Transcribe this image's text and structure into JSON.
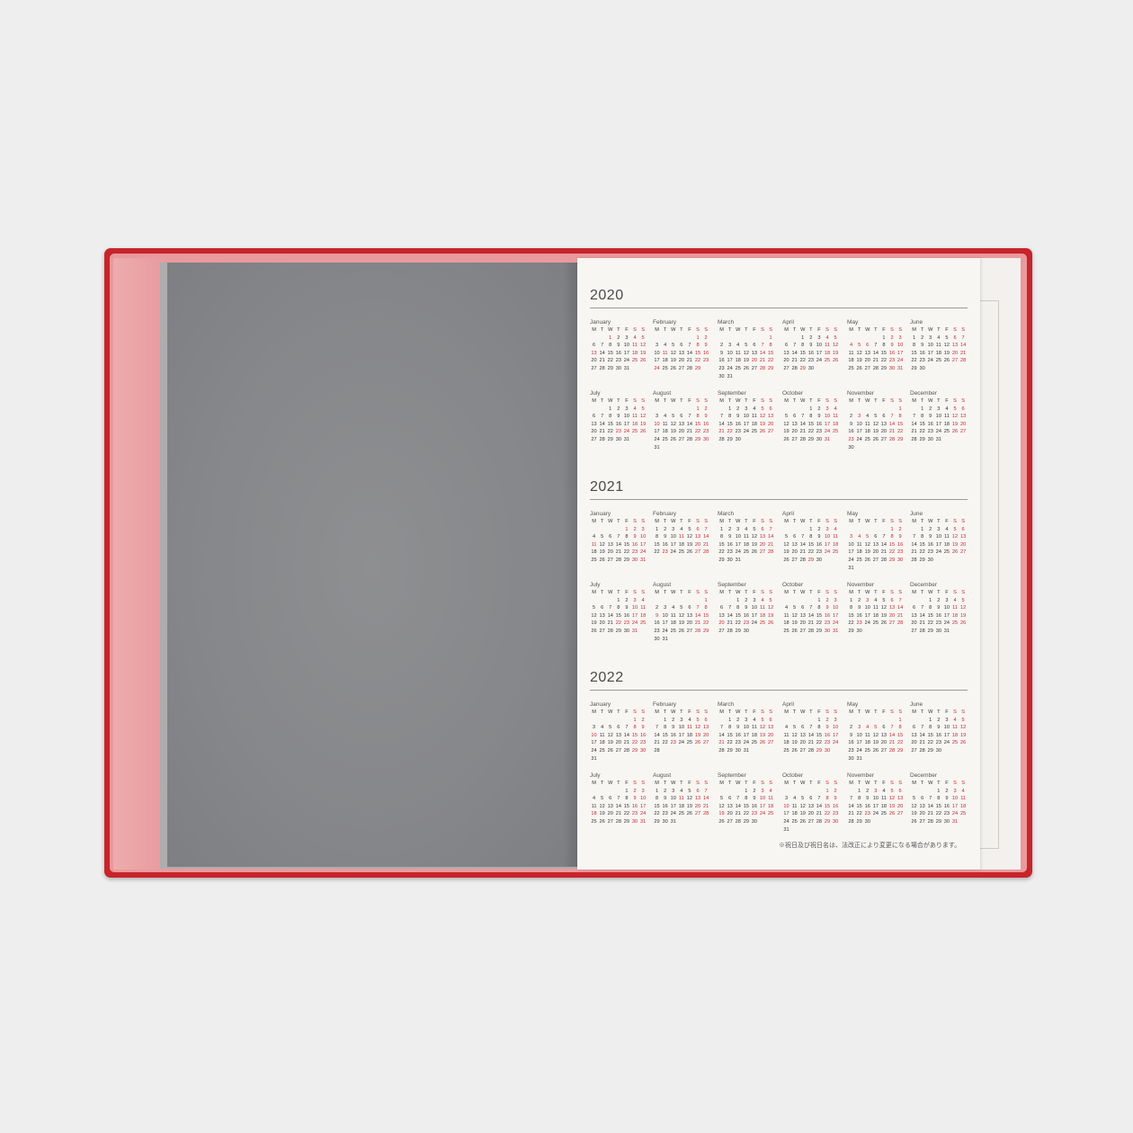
{
  "colors": {
    "cover": "#c8242b",
    "left_page": "#86878a",
    "right_page": "#f7f6f3",
    "holiday_red": "#c8242b"
  },
  "weekday_header": [
    "M",
    "T",
    "W",
    "T",
    "F",
    "S",
    "S"
  ],
  "footnote": "※祝日及び祝日名は、法改正により変更になる場合があります。",
  "years": [
    {
      "year": "2020",
      "months": [
        {
          "name": "January",
          "offset": 2,
          "days": 31,
          "holidays": [
            1,
            13
          ]
        },
        {
          "name": "February",
          "offset": 5,
          "days": 29,
          "holidays": [
            11,
            24
          ]
        },
        {
          "name": "March",
          "offset": 6,
          "days": 31,
          "holidays": [
            20
          ]
        },
        {
          "name": "April",
          "offset": 2,
          "days": 30,
          "holidays": [
            29
          ]
        },
        {
          "name": "May",
          "offset": 4,
          "days": 31,
          "holidays": [
            4,
            5,
            6
          ]
        },
        {
          "name": "June",
          "offset": 0,
          "days": 30,
          "holidays": []
        },
        {
          "name": "July",
          "offset": 2,
          "days": 31,
          "holidays": [
            23,
            24
          ]
        },
        {
          "name": "August",
          "offset": 5,
          "days": 31,
          "holidays": [
            10
          ]
        },
        {
          "name": "September",
          "offset": 1,
          "days": 30,
          "holidays": [
            21,
            22
          ]
        },
        {
          "name": "October",
          "offset": 3,
          "days": 31,
          "holidays": []
        },
        {
          "name": "November",
          "offset": 6,
          "days": 30,
          "holidays": [
            3,
            23
          ]
        },
        {
          "name": "December",
          "offset": 1,
          "days": 31,
          "holidays": []
        }
      ]
    },
    {
      "year": "2021",
      "months": [
        {
          "name": "January",
          "offset": 4,
          "days": 31,
          "holidays": [
            1,
            11
          ]
        },
        {
          "name": "February",
          "offset": 0,
          "days": 28,
          "holidays": [
            11,
            23
          ]
        },
        {
          "name": "March",
          "offset": 0,
          "days": 31,
          "holidays": [
            20
          ]
        },
        {
          "name": "April",
          "offset": 3,
          "days": 30,
          "holidays": [
            29
          ]
        },
        {
          "name": "May",
          "offset": 5,
          "days": 31,
          "holidays": [
            3,
            4,
            5
          ]
        },
        {
          "name": "June",
          "offset": 1,
          "days": 30,
          "holidays": []
        },
        {
          "name": "July",
          "offset": 3,
          "days": 31,
          "holidays": [
            22,
            23
          ]
        },
        {
          "name": "August",
          "offset": 6,
          "days": 31,
          "holidays": [
            8,
            9
          ]
        },
        {
          "name": "September",
          "offset": 2,
          "days": 30,
          "holidays": [
            20,
            23
          ]
        },
        {
          "name": "October",
          "offset": 4,
          "days": 31,
          "holidays": []
        },
        {
          "name": "November",
          "offset": 0,
          "days": 30,
          "holidays": [
            3,
            23
          ]
        },
        {
          "name": "December",
          "offset": 2,
          "days": 31,
          "holidays": []
        }
      ]
    },
    {
      "year": "2022",
      "months": [
        {
          "name": "January",
          "offset": 5,
          "days": 31,
          "holidays": [
            1,
            10
          ]
        },
        {
          "name": "February",
          "offset": 1,
          "days": 28,
          "holidays": [
            11,
            23
          ]
        },
        {
          "name": "March",
          "offset": 1,
          "days": 31,
          "holidays": [
            21
          ]
        },
        {
          "name": "April",
          "offset": 4,
          "days": 30,
          "holidays": [
            29
          ]
        },
        {
          "name": "May",
          "offset": 6,
          "days": 31,
          "holidays": [
            3,
            4,
            5
          ]
        },
        {
          "name": "June",
          "offset": 2,
          "days": 30,
          "holidays": []
        },
        {
          "name": "July",
          "offset": 4,
          "days": 31,
          "holidays": [
            18
          ]
        },
        {
          "name": "August",
          "offset": 0,
          "days": 31,
          "holidays": [
            11
          ]
        },
        {
          "name": "September",
          "offset": 3,
          "days": 30,
          "holidays": [
            19,
            23
          ]
        },
        {
          "name": "October",
          "offset": 5,
          "days": 31,
          "holidays": [
            10
          ]
        },
        {
          "name": "November",
          "offset": 1,
          "days": 30,
          "holidays": [
            3,
            23
          ]
        },
        {
          "name": "December",
          "offset": 3,
          "days": 31,
          "holidays": []
        }
      ]
    }
  ]
}
